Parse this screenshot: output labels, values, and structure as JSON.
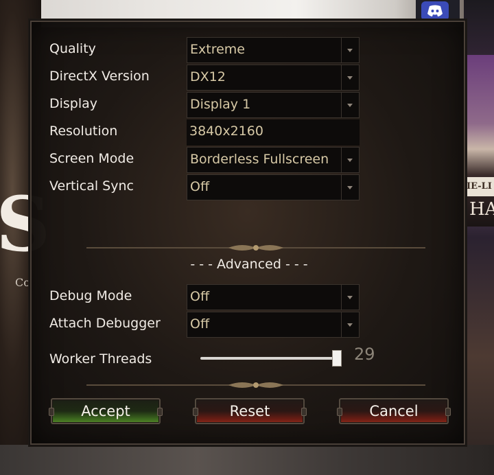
{
  "settings": {
    "quality": {
      "label": "Quality",
      "value": "Extreme"
    },
    "directx": {
      "label": "DirectX Version",
      "value": "DX12"
    },
    "display": {
      "label": "Display",
      "value": "Display 1"
    },
    "resolution": {
      "label": "Resolution",
      "value": "3840x2160"
    },
    "screen_mode": {
      "label": "Screen Mode",
      "value": "Borderless Fullscreen"
    },
    "vsync": {
      "label": "Vertical Sync",
      "value": "Off"
    }
  },
  "advanced": {
    "heading": "- - - Advanced - - -",
    "debug_mode": {
      "label": "Debug Mode",
      "value": "Off"
    },
    "attach_debugger": {
      "label": "Attach Debugger",
      "value": "Off"
    },
    "worker_threads": {
      "label": "Worker Threads",
      "value": "29"
    }
  },
  "buttons": {
    "accept": "Accept",
    "reset": "Reset",
    "cancel": "Cancel"
  },
  "background": {
    "big_letter": "S",
    "small_text": "Co",
    "right_strip": "IE-LI",
    "right_big": "HAT"
  },
  "icons": {
    "discord": "discord-icon",
    "dropdown": "chevron-down-icon"
  },
  "colors": {
    "value_text": "#d7c9a6",
    "accept_green": "#53852a",
    "reset_red": "#8a2a1a"
  }
}
